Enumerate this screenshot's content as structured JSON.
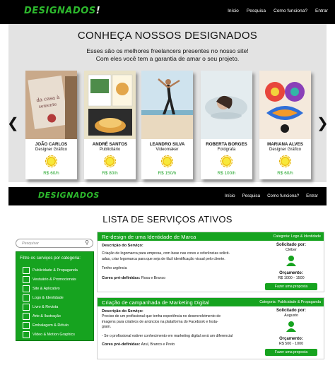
{
  "brand": {
    "logo": "DESIGNADOS",
    "logo_mark": "!",
    "accent": "#16a31f",
    "nav_bg": "#000000"
  },
  "nav": {
    "links": [
      "Início",
      "Pesquisa",
      "Como funciona?",
      "Entrar"
    ]
  },
  "hero": {
    "title": "CONHEÇA NOSSOS DESIGNADOS",
    "subtitle_1": "Esses são os melhores freelancers presentes no nosso site!",
    "subtitle_2": "Com eles você tem a garantia de amar o seu projeto.",
    "prev_icon": "chevron-left-icon",
    "next_icon": "chevron-right-icon",
    "freelancers": [
      {
        "name": "JOÃO CARLOS",
        "role": "Designer Gráfico",
        "price": "R$ 60/h"
      },
      {
        "name": "ANDRÉ SANTOS",
        "role": "Publicitário",
        "price": "R$ 80/h"
      },
      {
        "name": "LEANDRO SILVA",
        "role": "Videomaker",
        "price": "R$ 150/h"
      },
      {
        "name": "ROBERTA BORGES",
        "role": "Fotógrafa",
        "price": "R$ 100/h"
      },
      {
        "name": "MARIANA ALVES",
        "role": "Designer Gráfico",
        "price": "R$ 60/h"
      }
    ]
  },
  "services": {
    "title": "LISTA DE SERVIÇOS ATIVOS",
    "search": {
      "placeholder": "Pesquisar",
      "icon": "search-icon"
    },
    "filter": {
      "title": "Filtre os serviços por categoria:",
      "categories": [
        "Publicidade & Propaganda",
        "Vestuário & Promocionais",
        "Site & Aplicativo",
        "Logo & Identidade",
        "Livro & Revista",
        "Arte & Ilustração",
        "Embalagem & Rótulo",
        "Vídeo & Motion Graphics"
      ]
    },
    "items": [
      {
        "title": "Re-design de uma Identidade de Marca",
        "category": "Categoria: Logo & Identidade",
        "desc_label": "Descrição do Serviço:",
        "desc_1": "Criação de logomarca para empresa, com base nas cores e referências solicit-",
        "desc_2": "adas, criar logomarca para que seja de fácil identificação visual pelo cliente.",
        "desc_3": "Tenho urgência",
        "colors_label": "Cores pré-definidas:",
        "colors": "Rosa e Branco",
        "requested_label": "Solicitado por:",
        "requester": "Cléber",
        "budget_label": "Orçamento:",
        "budget": "R$ 1000 - 1500",
        "cta": "Fazer uma proposta"
      },
      {
        "title": "Criação de campanhada de Marketing Digital",
        "category": "Categoria: Publicidade & Propaganda",
        "desc_label": "Descrição do Serviço:",
        "desc_1": "Preciso de um profissional que tenha experiência no desenvolvimento de",
        "desc_2": "imagens para criativos de anúncios na plataforma do Facebook e Insta-",
        "desc_2b": "gram.",
        "desc_3": "- Se o profissional estiver conhecimento em marketing digital será um diferencial",
        "colors_label": "Cores pré-definidas:",
        "colors": "Azul, Branco e Preto",
        "requested_label": "Solicitado por:",
        "requester": "Augusto",
        "budget_label": "Orçamento:",
        "budget": "R$ 500 - 1000",
        "cta": "Fazer uma proposta"
      }
    ]
  }
}
